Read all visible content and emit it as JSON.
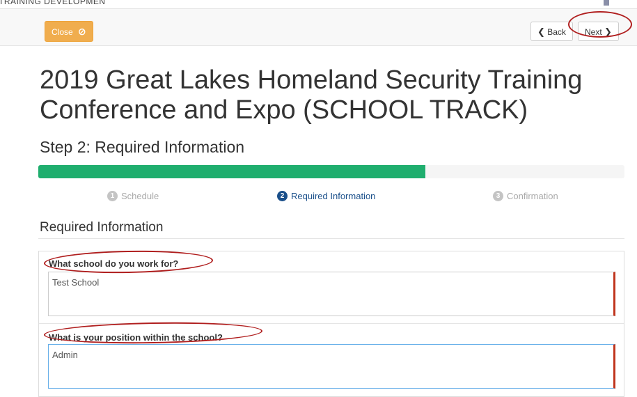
{
  "top_strip_text": "TRAINING DEVELOPMEN",
  "toolbar": {
    "close_label": "Close",
    "close_icon": "⊘",
    "back_label": "Back",
    "next_label": "Next",
    "back_icon": "❮",
    "next_icon": "❯"
  },
  "page_title": "2019 Great Lakes Homeland Security Training Conference and Expo (SCHOOL TRACK)",
  "step_title": "Step 2: Required Information",
  "progress": {
    "fraction": 0.66,
    "color": "#1fae6e"
  },
  "steps": [
    {
      "number": "1",
      "label": "Schedule",
      "state": "inactive"
    },
    {
      "number": "2",
      "label": "Required Information",
      "state": "active"
    },
    {
      "number": "3",
      "label": "Confirmation",
      "state": "inactive"
    }
  ],
  "section_title": "Required Information",
  "fields": [
    {
      "label": "What school do you work for?",
      "value": "Test School"
    },
    {
      "label": "What is your position within the school?",
      "value": "Admin"
    }
  ],
  "annotation_color": "#b01e1e"
}
